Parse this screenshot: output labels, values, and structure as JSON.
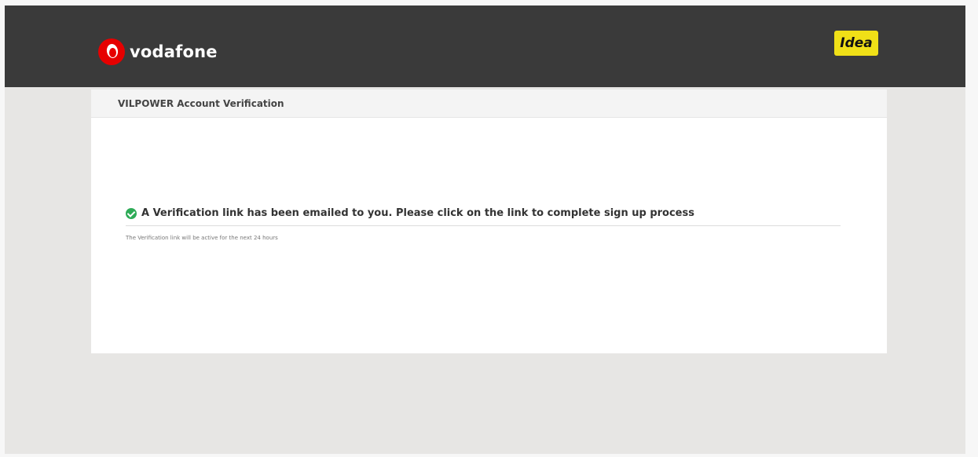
{
  "header": {
    "brand_name": "vodafone",
    "partner_logo": "Idea",
    "background": "#3a3a3a",
    "brand_color": "#e60000",
    "partner_color": "#f0e017"
  },
  "card": {
    "title": "VILPOWER Account Verification",
    "message": "A Verification link has been emailed to you. Please click on the link to complete sign up process",
    "subtext": "The Verification link will be active for the next 24 hours",
    "success_color": "#2eab57"
  }
}
